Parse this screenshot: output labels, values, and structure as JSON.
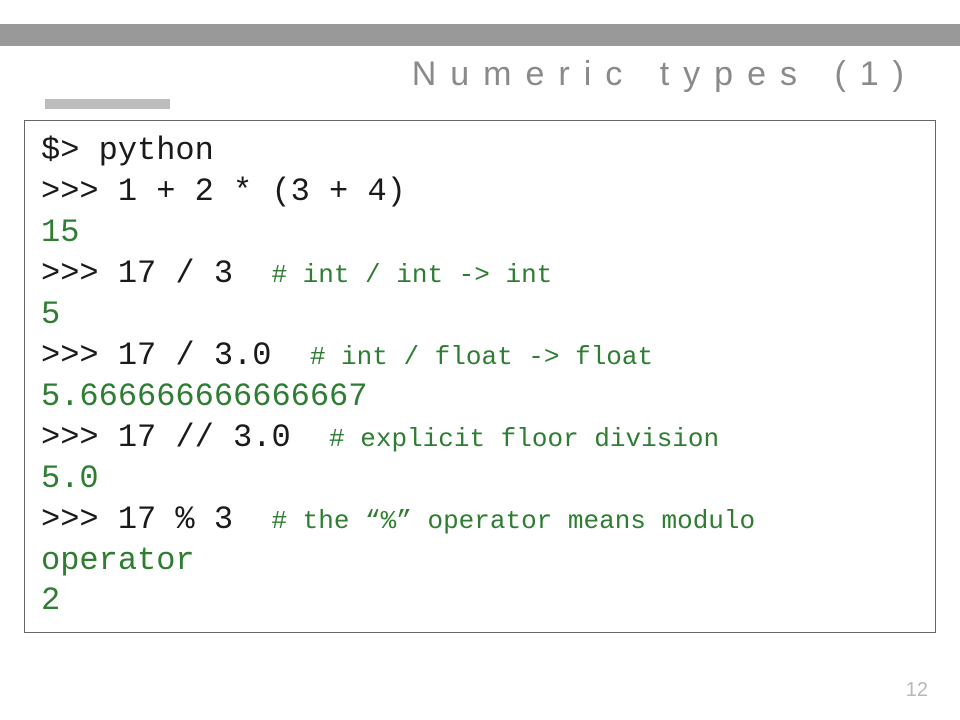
{
  "slide": {
    "title": "Numeric types (1)",
    "page_number": "12"
  },
  "code": {
    "l1": "$> python",
    "l2a": ">>> 1 + 2 * (3 + 4)",
    "l2_out": "15",
    "l3a": ">>> 17 / 3  ",
    "l3c": "# int / int -> int",
    "l3_out": "5",
    "l4a": ">>> 17 / 3.0  ",
    "l4c": "# int / float -> float",
    "l4_out": "5.666666666666667",
    "l5a": ">>> 17 // 3.0  ",
    "l5c": "# explicit floor division",
    "l5_out": "5.0",
    "l6a": ">>> 17 % 3  ",
    "l6c": "# the “%” operator means modulo",
    "l6c2": "operator",
    "l6_out": "2"
  }
}
